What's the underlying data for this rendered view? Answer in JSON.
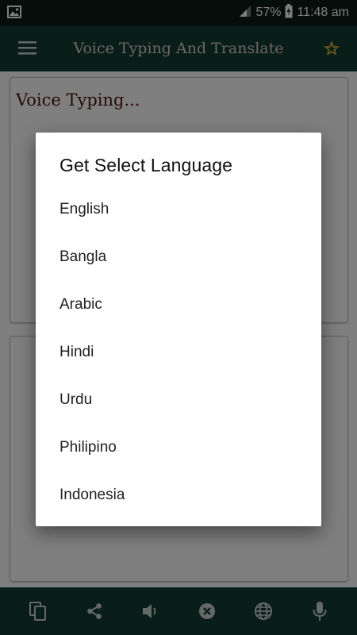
{
  "status_bar": {
    "battery_percent": "57%",
    "time": "11:48 am",
    "icons": [
      "image-notification-icon",
      "signal-icon",
      "battery-icon"
    ]
  },
  "app_bar": {
    "title": "Voice Typing And Translate",
    "icons": [
      "menu-icon",
      "star-icon"
    ],
    "accent_color": "#c8a23a"
  },
  "main": {
    "voice_placeholder": "Voice Typing..."
  },
  "dialog": {
    "title": "Get Select Language",
    "languages": [
      "English",
      "Bangla",
      "Arabic",
      "Hindi",
      "Urdu",
      "Philipino",
      "Indonesia"
    ]
  },
  "bottom_bar": {
    "icons": [
      "copy-icon",
      "share-icon",
      "volume-icon",
      "clear-icon",
      "globe-icon",
      "microphone-icon"
    ]
  },
  "colors": {
    "app_bar": "#123b33",
    "status_bar": "#0c1d19",
    "title_text": "#d7d0c4",
    "voice_text": "#4a1414"
  }
}
